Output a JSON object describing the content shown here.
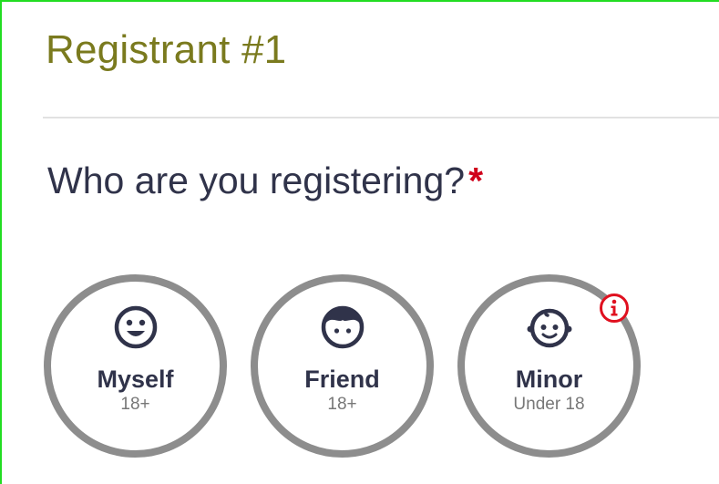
{
  "section": {
    "title": "Registrant #1"
  },
  "question": {
    "text": "Who are you registering?",
    "required_marker": "*"
  },
  "options": [
    {
      "label": "Myself",
      "sublabel": "18+",
      "icon": "smiley-face-icon"
    },
    {
      "label": "Friend",
      "sublabel": "18+",
      "icon": "person-face-icon"
    },
    {
      "label": "Minor",
      "sublabel": "Under 18",
      "icon": "baby-face-icon"
    }
  ],
  "info_icon": "info-icon",
  "colors": {
    "title": "#7a7a1e",
    "text": "#30334a",
    "required": "#d0021b",
    "circle_border": "#8d8d8d",
    "info": "#e0101f",
    "frame": "#22dd22"
  }
}
